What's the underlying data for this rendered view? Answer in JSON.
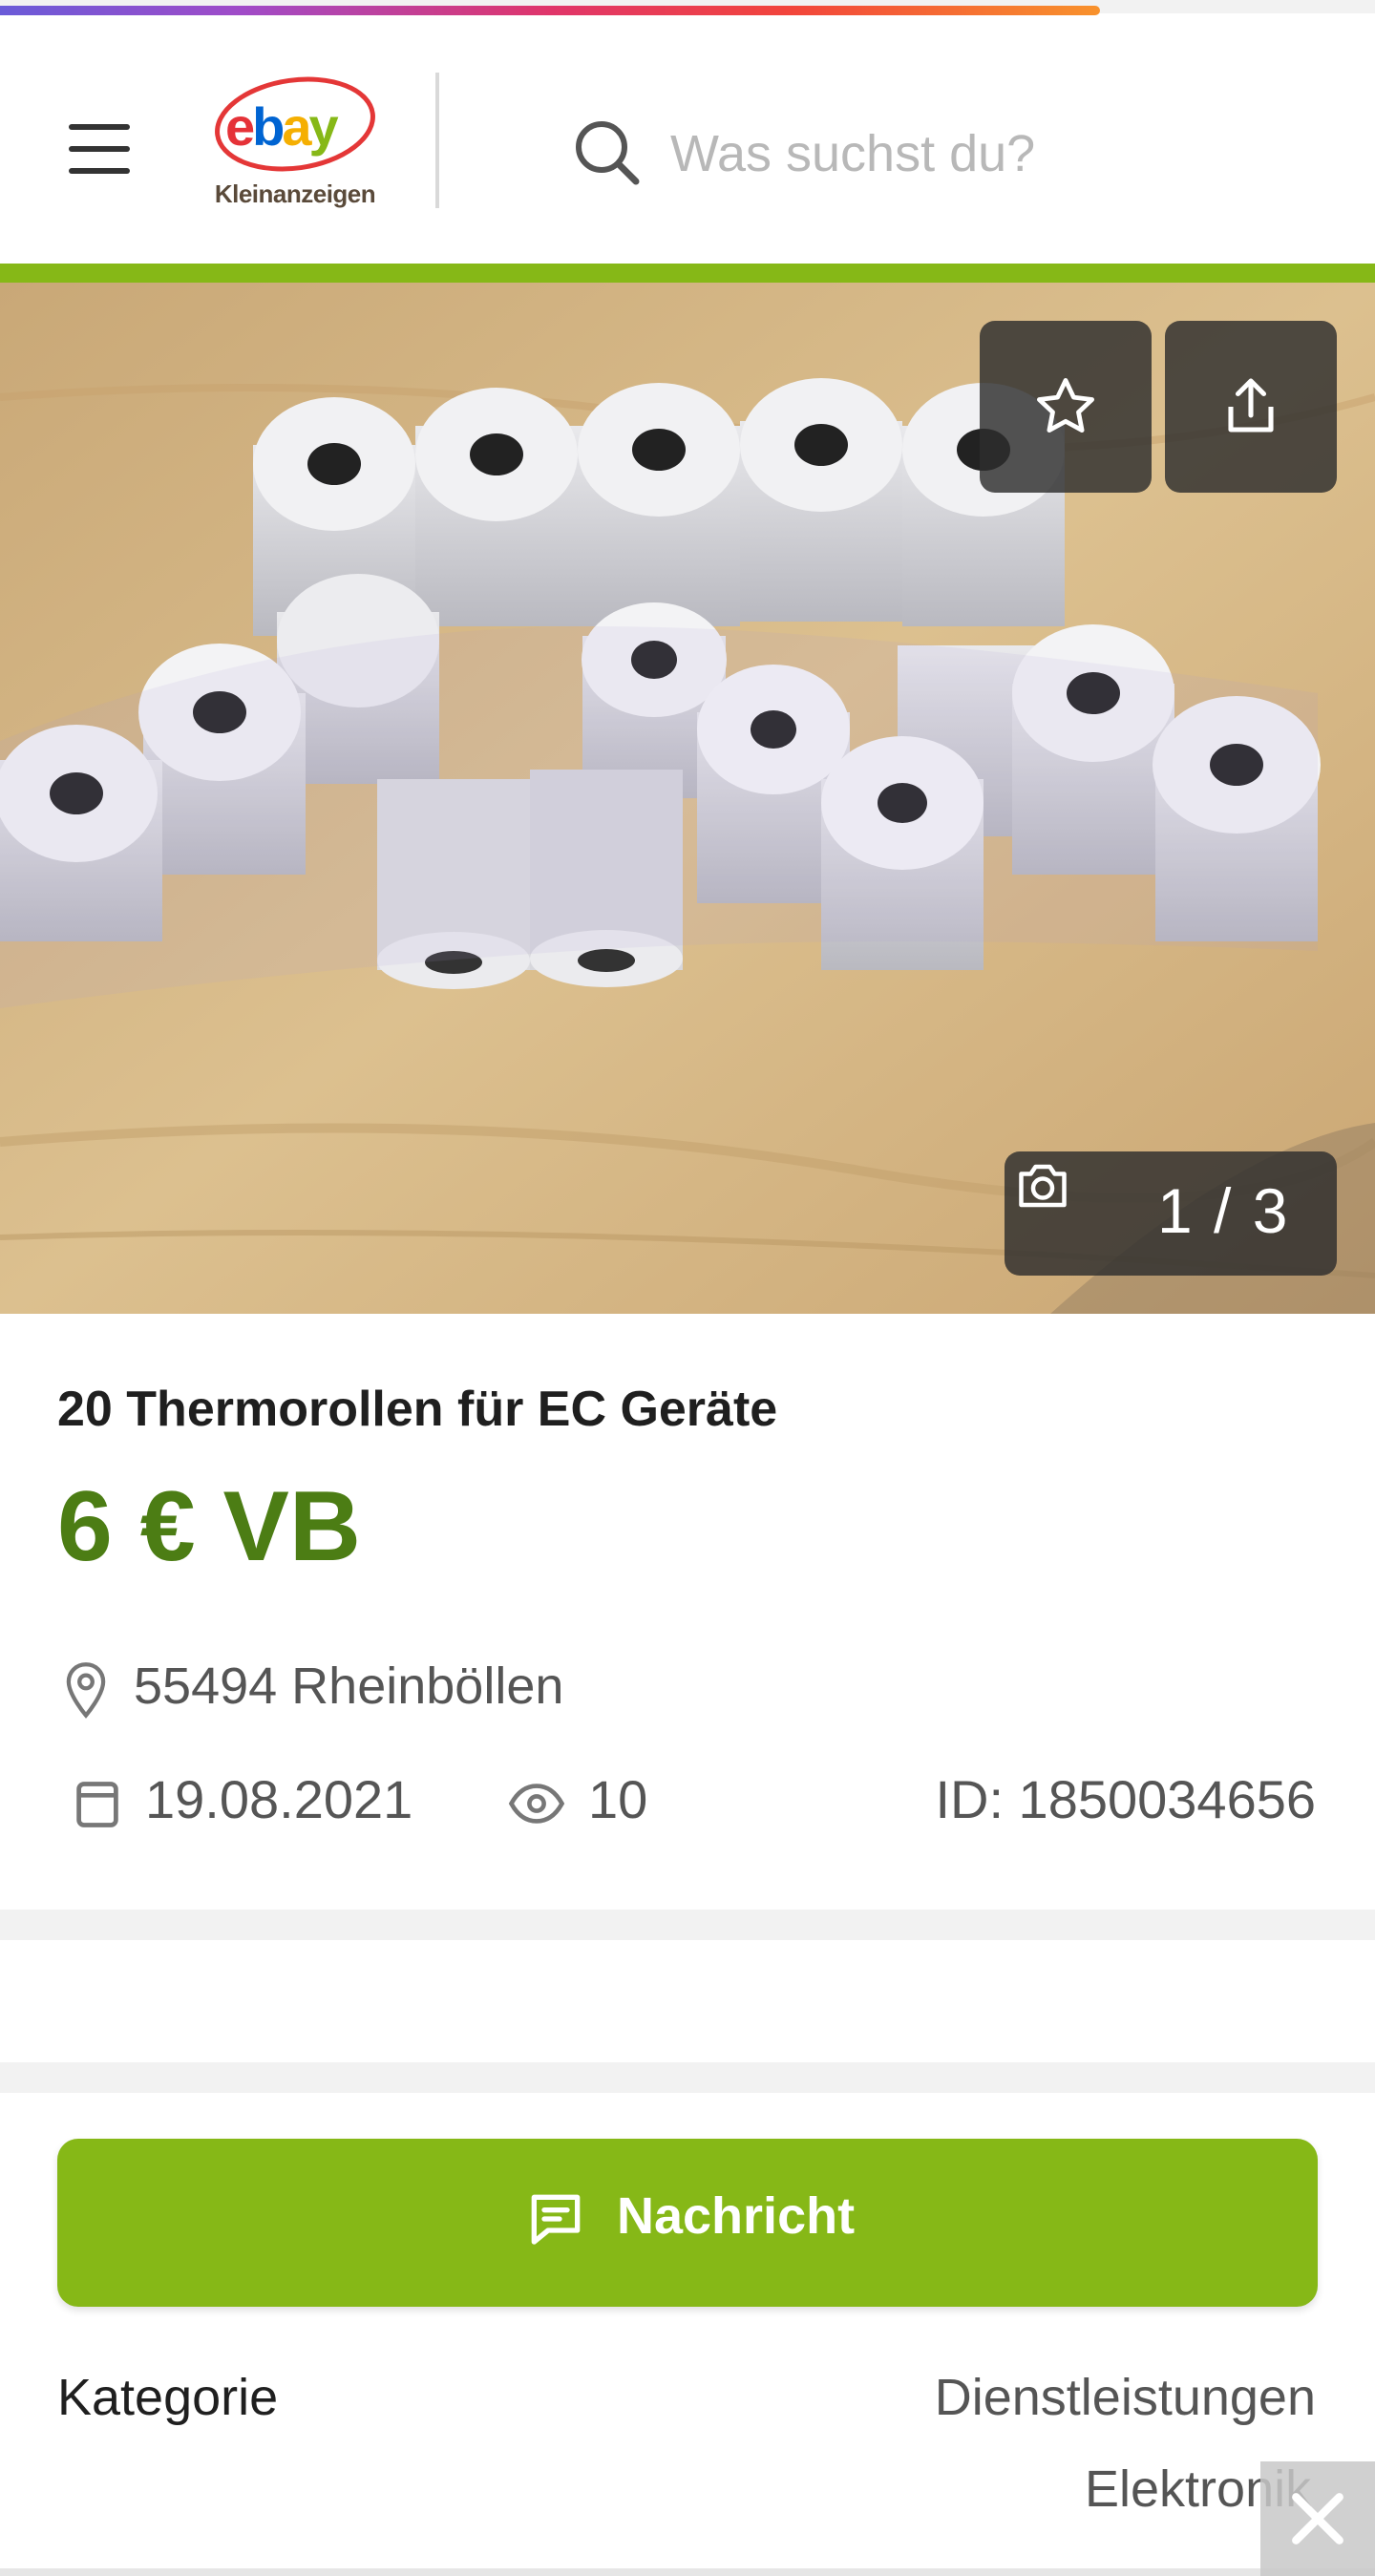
{
  "loading": {
    "progress": 0.8
  },
  "header": {
    "logo_main": "ebay",
    "logo_sub": "Kleinanzeigen",
    "search_placeholder": "Was suchst du?"
  },
  "gallery": {
    "counter": "1 / 3",
    "icons": [
      "star-icon",
      "share-icon",
      "camera-icon"
    ]
  },
  "listing": {
    "title": "20 Thermorollen für EC Geräte",
    "price": "6 € VB",
    "location": "55494 Rheinböllen",
    "date": "19.08.2021",
    "views": "10",
    "id": "ID: 1850034656"
  },
  "actions": {
    "message_label": "Nachricht"
  },
  "details": {
    "category_label": "Kategorie",
    "category_value_line1": "Dienstleistungen",
    "category_value_line2": "Elektronik"
  },
  "colors": {
    "brand_green": "#86b817",
    "price_green": "#4c7d14"
  }
}
